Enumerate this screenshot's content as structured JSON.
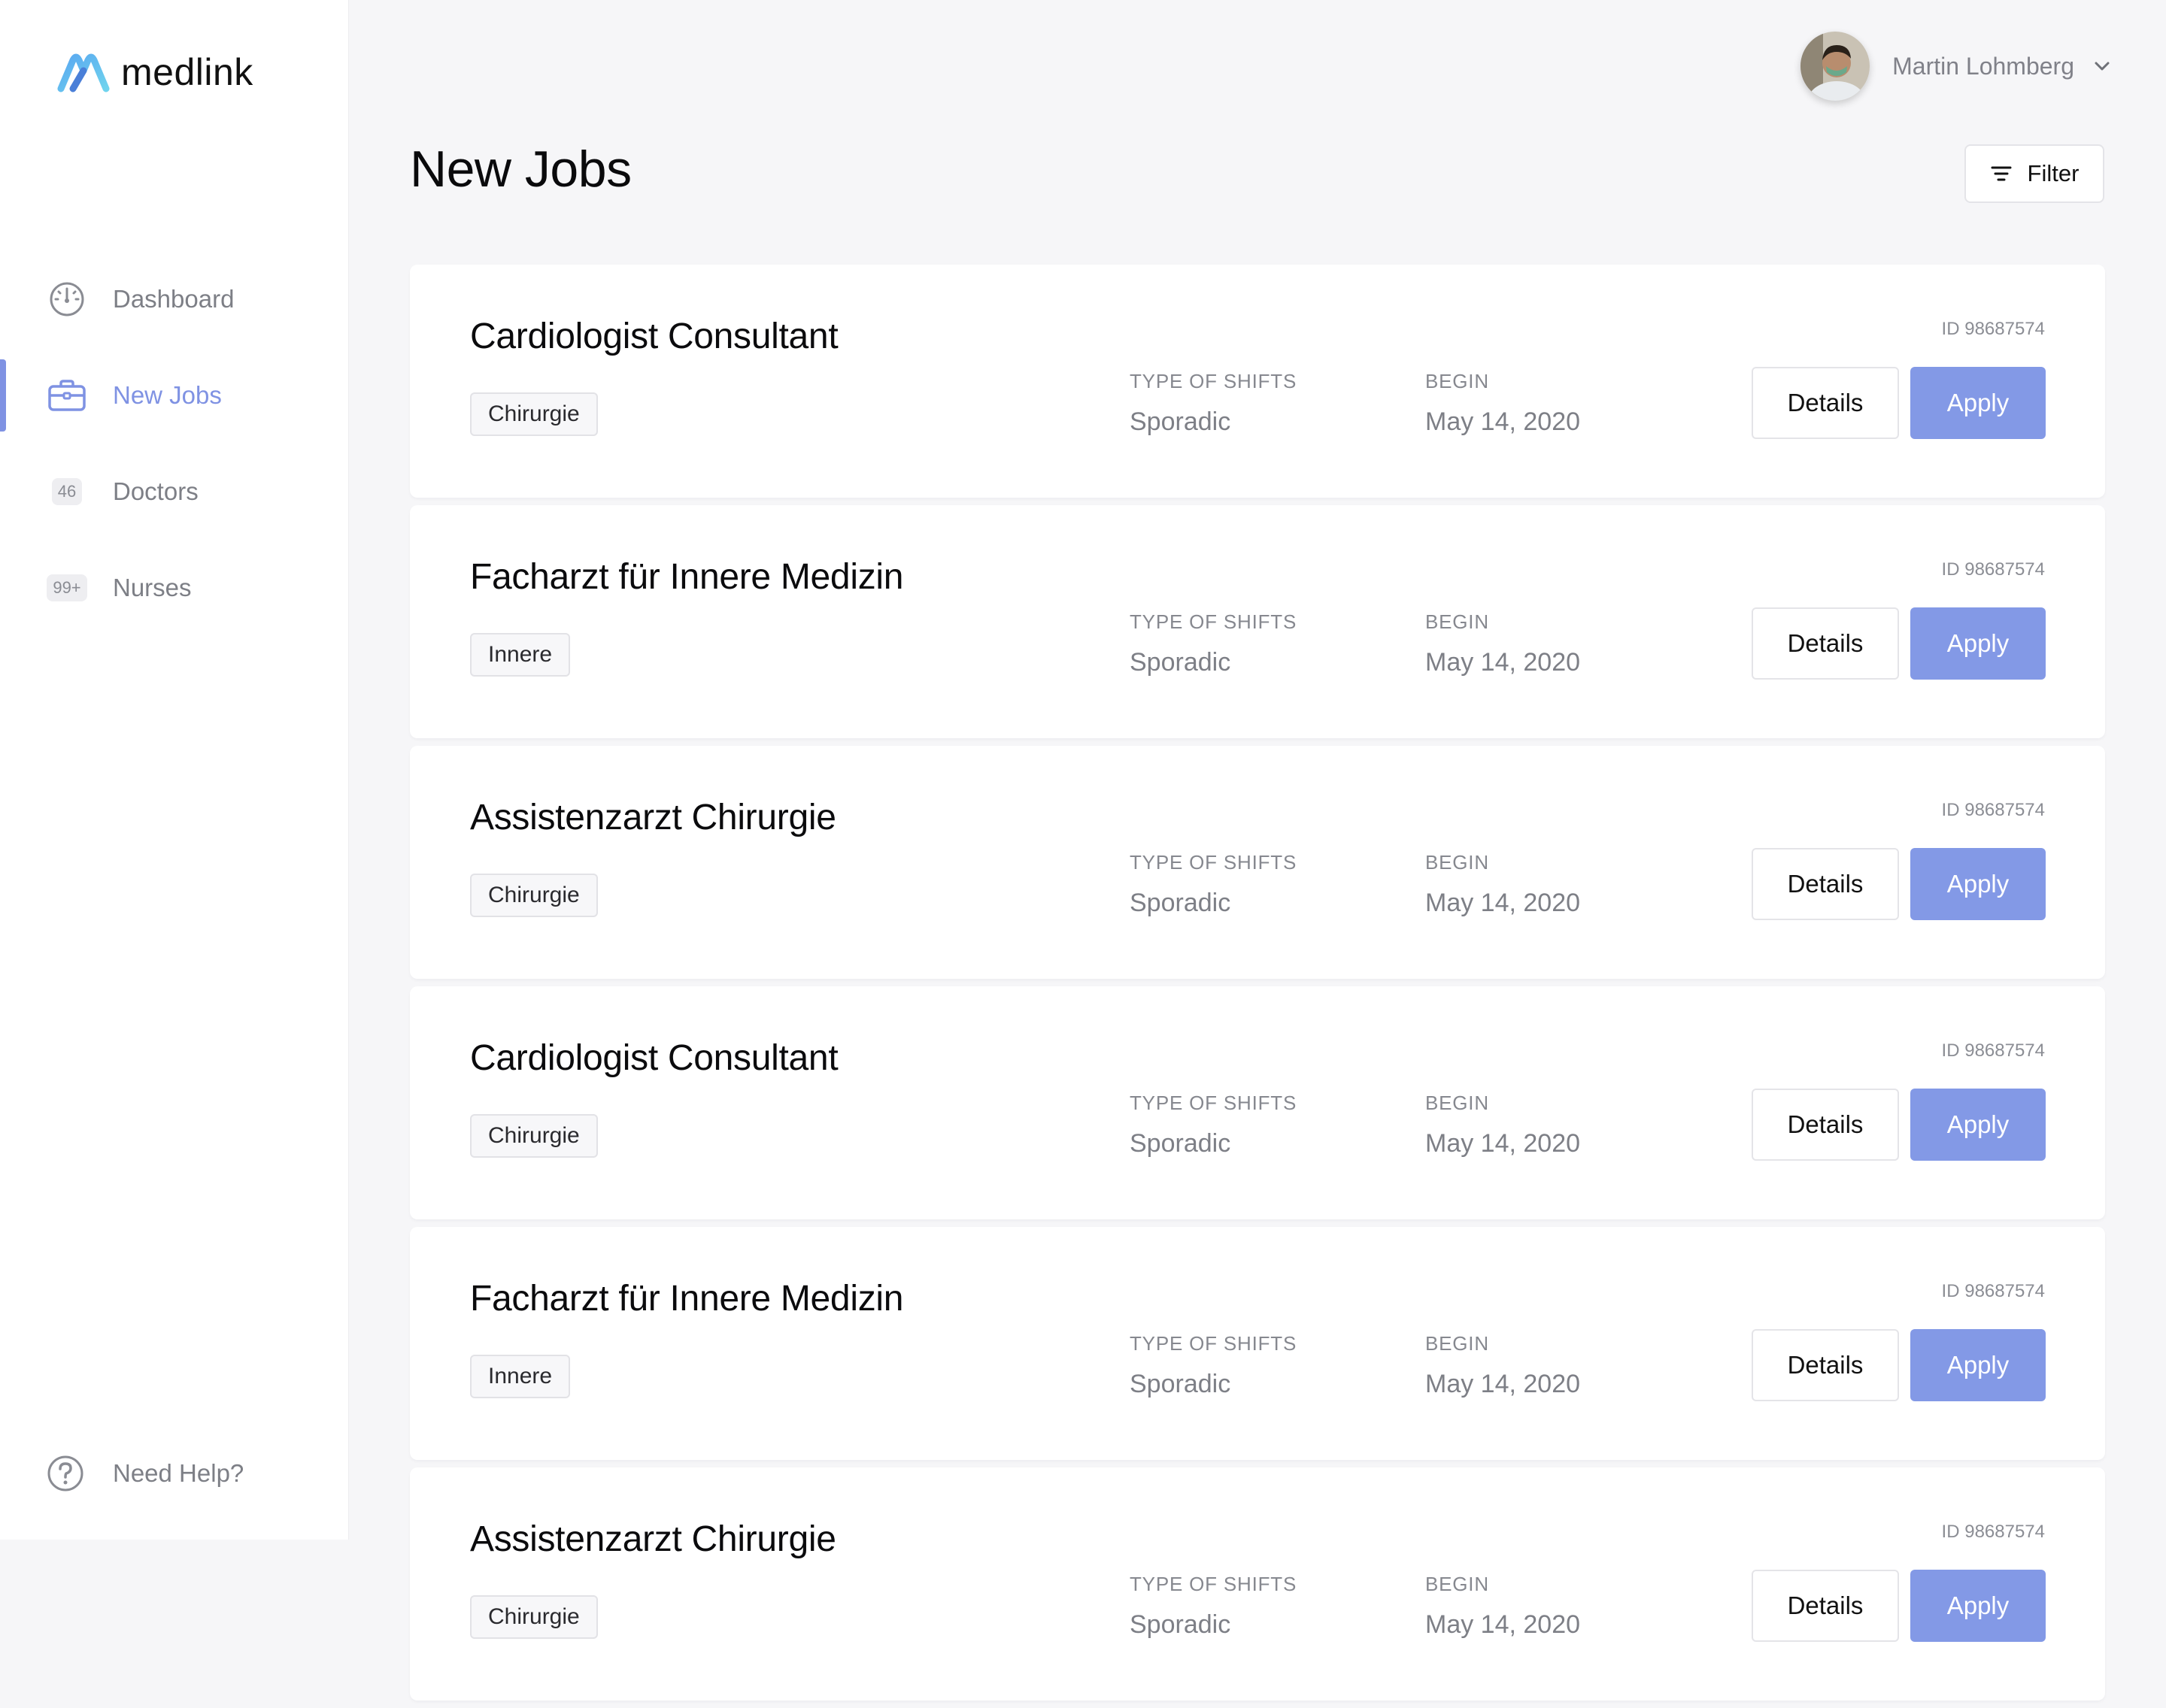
{
  "brand": {
    "name": "medlink",
    "color": "#6fb8f0"
  },
  "sidebar": {
    "items": [
      {
        "label": "Dashboard",
        "icon": "gauge-icon",
        "active": false
      },
      {
        "label": "New Jobs",
        "icon": "briefcase-icon",
        "active": true
      },
      {
        "label": "Doctors",
        "badge": "46",
        "active": false
      },
      {
        "label": "Nurses",
        "badge": "99+",
        "active": false
      }
    ],
    "help": {
      "label": "Need Help?",
      "icon": "question-circle-icon"
    }
  },
  "header": {
    "user": {
      "name": "Martin Lohmberg"
    },
    "title": "New Jobs",
    "filter_label": "Filter"
  },
  "colors": {
    "accent": "#7f92e3",
    "apply_button": "#8399e6"
  },
  "jobs": [
    {
      "title": "Cardiologist Consultant",
      "tag": "Chirurgie",
      "shift_label": "TYPE OF SHIFTS",
      "shift": "Sporadic",
      "begin_label": "BEGIN",
      "begin": "May 14, 2020",
      "id": "ID 98687574",
      "details_label": "Details",
      "apply_label": "Apply"
    },
    {
      "title": "Facharzt für Innere Medizin",
      "tag": "Innere",
      "shift_label": "TYPE OF SHIFTS",
      "shift": "Sporadic",
      "begin_label": "BEGIN",
      "begin": "May 14, 2020",
      "id": "ID 98687574",
      "details_label": "Details",
      "apply_label": "Apply"
    },
    {
      "title": "Assistenzarzt Chirurgie",
      "tag": "Chirurgie",
      "shift_label": "TYPE OF SHIFTS",
      "shift": "Sporadic",
      "begin_label": "BEGIN",
      "begin": "May 14, 2020",
      "id": "ID 98687574",
      "details_label": "Details",
      "apply_label": "Apply"
    },
    {
      "title": "Cardiologist Consultant",
      "tag": "Chirurgie",
      "shift_label": "TYPE OF SHIFTS",
      "shift": "Sporadic",
      "begin_label": "BEGIN",
      "begin": "May 14, 2020",
      "id": "ID 98687574",
      "details_label": "Details",
      "apply_label": "Apply"
    },
    {
      "title": "Facharzt für Innere Medizin",
      "tag": "Innere",
      "shift_label": "TYPE OF SHIFTS",
      "shift": "Sporadic",
      "begin_label": "BEGIN",
      "begin": "May 14, 2020",
      "id": "ID 98687574",
      "details_label": "Details",
      "apply_label": "Apply"
    },
    {
      "title": "Assistenzarzt Chirurgie",
      "tag": "Chirurgie",
      "shift_label": "TYPE OF SHIFTS",
      "shift": "Sporadic",
      "begin_label": "BEGIN",
      "begin": "May 14, 2020",
      "id": "ID 98687574",
      "details_label": "Details",
      "apply_label": "Apply"
    }
  ]
}
